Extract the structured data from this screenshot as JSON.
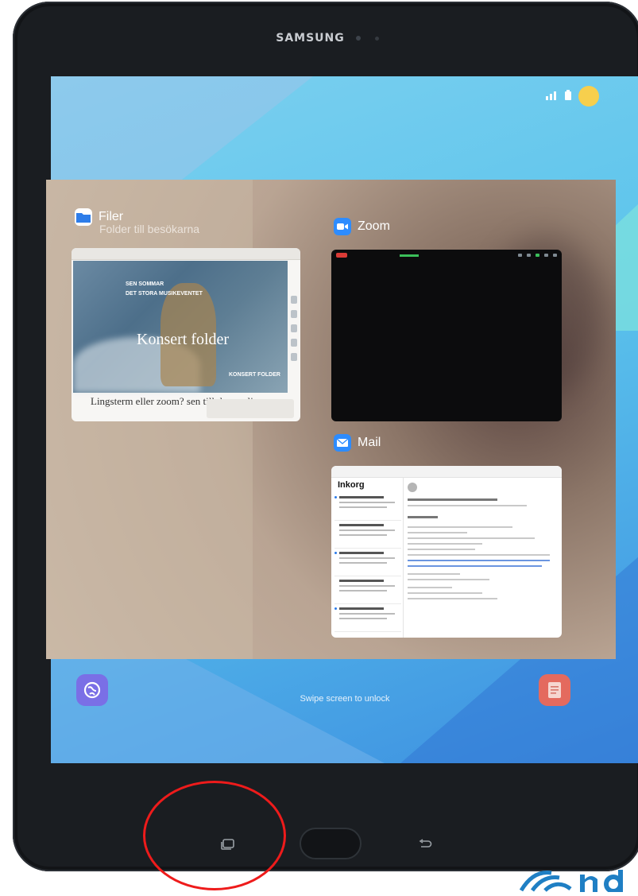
{
  "device": {
    "brand": "SAMSUNG"
  },
  "recents": {
    "apps": [
      {
        "name": "Filer",
        "subtitle": "Folder till besökarna"
      },
      {
        "name": "Zoom"
      },
      {
        "name": "Mail"
      }
    ],
    "filer_preview": {
      "hero_title": "Konsert folder",
      "footer_text": "Lingsterm eller zoom? sen till dwomelja"
    },
    "mail_preview": {
      "inbox_title": "Inkorg"
    }
  },
  "lockscreen": {
    "unlock_hint": "Swipe screen to unlock"
  },
  "navbar": {
    "buttons": [
      "recents",
      "home",
      "back"
    ]
  },
  "colors": {
    "accent": "#2b7be9",
    "highlight_circle": "#ee1b1b",
    "logo": "#1f7fc4"
  }
}
